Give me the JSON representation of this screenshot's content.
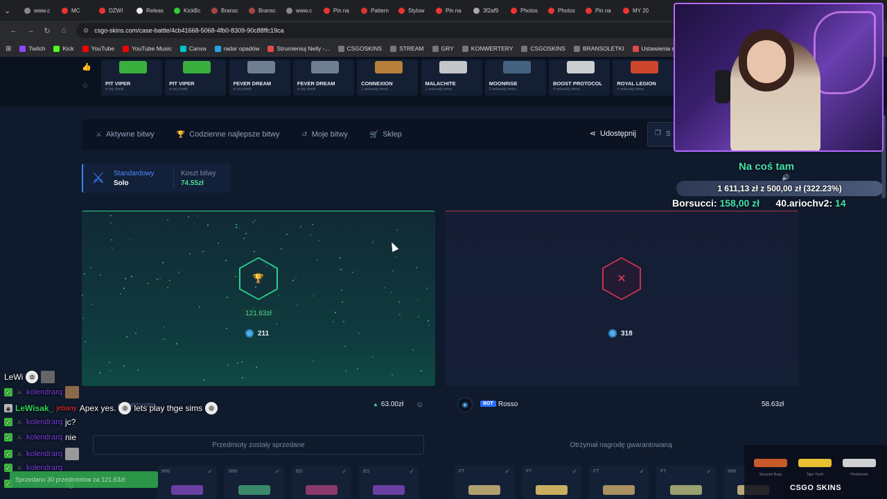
{
  "browser": {
    "tabs": [
      "www.c",
      "MC",
      "DŹWI",
      "Releas",
      "KickBc",
      "Bransc",
      "Bransc",
      "www.c",
      "Pin na",
      "Pattern",
      "Stylow",
      "Pin na",
      "3f2af9",
      "Photos",
      "Photos",
      "Pin na",
      "MY 20"
    ],
    "url": "csgo-skins.com/case-battle/4cb41668-5068-4fb0-8309-90c88ffc19ca",
    "bookmarks": [
      "Twitch",
      "Kick",
      "YouTube",
      "YouTube Music",
      "Canva",
      "radar opadów",
      "Strumieniuj Nelly -...",
      "CSGOSKINS",
      "STREAM",
      "GRY",
      "KONWERTERY",
      "CSGOSKINS",
      "BRANSOLETKI",
      "Ustawienia strumien..."
    ]
  },
  "live_drops": [
    {
      "name": "PIT VIPER",
      "sub": "w tej chwili",
      "color": "#3fbf3f"
    },
    {
      "name": "PIT VIPER",
      "sub": "w tej chwili",
      "color": "#3fbf3f"
    },
    {
      "name": "FEVER DREAM",
      "sub": "w tej chwili",
      "color": "#7a8a9a"
    },
    {
      "name": "FEVER DREAM",
      "sub": "w tej chwili",
      "color": "#7a8a9a"
    },
    {
      "name": "CONNEXION",
      "sub": "1 sekundy temu",
      "color": "#c98a3a"
    },
    {
      "name": "MALACHITE",
      "sub": "1 sekundy temu",
      "color": "#d8d8d8"
    },
    {
      "name": "MOONRISE",
      "sub": "3 sekundy temu",
      "color": "#4a6a8a"
    },
    {
      "name": "BOOST PROTOCOL",
      "sub": "4 sekundy temu",
      "color": "#e0e0e0"
    },
    {
      "name": "ROYAL LEGION",
      "sub": "4 sekundy temu",
      "color": "#e04a2a"
    }
  ],
  "menu": {
    "items": [
      {
        "label": "Aktywne bitwy",
        "icon": "swords-icon"
      },
      {
        "label": "Codzienne najlepsze bitwy",
        "icon": "trophy-icon"
      },
      {
        "label": "Moje bitwy",
        "icon": "history-icon"
      },
      {
        "label": "Sklep",
        "icon": "cart-icon"
      }
    ],
    "share_label": "Udostępnij",
    "extra_label": "S"
  },
  "battle": {
    "mode_label": "Standardowy",
    "mode_value": "Solo",
    "cost_label": "Koszt bitwy",
    "cost_value": "74.55zł"
  },
  "left_panel": {
    "win_amount": "121.63zł",
    "coins": "211",
    "player_name": "pastaMonster",
    "total": "63.00zł",
    "status": "Przedmioty zostały sprzedane"
  },
  "right_panel": {
    "coins": "318",
    "bot_badge": "BOT",
    "player_name": "Rosso",
    "total": "58.63zł",
    "status": "Otrzymał nagrodę gwarantowaną"
  },
  "items_left": [
    "MW",
    "MW",
    "BS",
    "BS"
  ],
  "items_right": [
    "FT",
    "FT",
    "FT",
    "FT",
    "MW"
  ],
  "overlay": {
    "goal_title": "Na coś tam",
    "goal_progress": "1 611,13 zł z 500,00 zł (322.23%)",
    "goal_fraction": 3.2223,
    "ticker_name_1": "Borsucci:",
    "ticker_amount_1": "158,00 zł",
    "ticker_name_2": "40.ariochv2:",
    "ticker_amount_2": "14"
  },
  "chat": [
    {
      "user": "LeWi",
      "msg": ""
    },
    {
      "user": "kolendrarq",
      "msg": ""
    },
    {
      "user": "LeWisak_",
      "tag": "jebany",
      "msg": "Apex yes.",
      "msg2": "lets play thge sims"
    },
    {
      "user": "kolendrarq",
      "msg": "jc?"
    },
    {
      "user": "kolendrarq",
      "msg": "nie"
    },
    {
      "user": "kolendrarq",
      "msg": ""
    },
    {
      "user": "kolendrarq",
      "msg": ""
    },
    {
      "user": "kolendrarq",
      "msg": "ajj"
    }
  ],
  "toast": "Sprzedano 30 przedmiotów za 121.63zł",
  "widget": {
    "items": [
      "Souvenir Rugs",
      "Tiger Tooth",
      "Printstream"
    ],
    "logo": "CSGO SKINS"
  }
}
